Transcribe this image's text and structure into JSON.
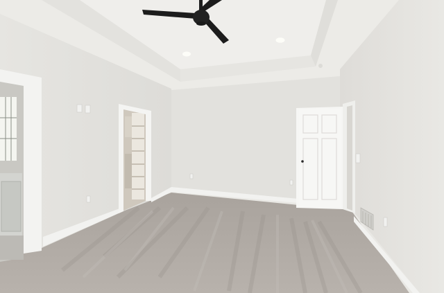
{
  "scene": {
    "subject": "empty-bedroom-interior",
    "elements": [
      "ceiling-fan",
      "tray-ceiling",
      "recessed-lights",
      "closet-doorway",
      "bathroom-doorway",
      "white-panel-door",
      "carpet-floor",
      "floor-vent"
    ]
  },
  "colors": {
    "wall": "#e4e3df",
    "wall-shadow": "#d6d5d0",
    "ceiling": "#ecebe8",
    "trim": "#f4f4f2",
    "carpet": "#b2aca6",
    "carpet-dark": "#9f9892",
    "fan": "#1d1d1d",
    "door": "#f6f6f4"
  }
}
